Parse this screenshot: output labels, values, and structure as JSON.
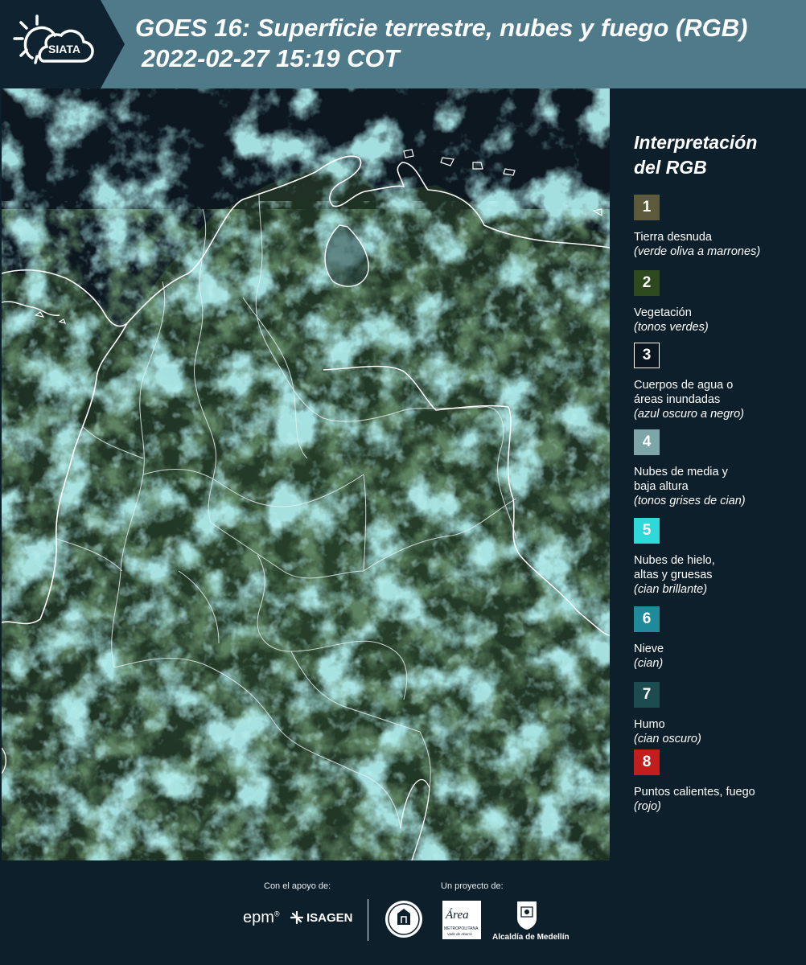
{
  "header": {
    "title": "GOES 16: Superficie terrestre, nubes y fuego (RGB)",
    "subtitle": "2022-02-27 15:19 COT",
    "logo_text": "SIATA"
  },
  "legend": {
    "title_line1": "Interpretación",
    "title_line2": "del RGB",
    "items": [
      {
        "number": "1",
        "name": "Tierra desnuda",
        "desc": "(verde oliva a marrones)",
        "color": "#5e5a3c"
      },
      {
        "number": "2",
        "name": "Vegetación",
        "desc": "(tonos verdes)",
        "color": "#2d4a1e"
      },
      {
        "number": "3",
        "name": "Cuerpos de agua o\náreas inundadas",
        "desc": "(azul oscuro a negro)",
        "color": "#0a1620"
      },
      {
        "number": "4",
        "name": "Nubes de media y\nbaja altura",
        "desc": "(tonos grises de cian)",
        "color": "#7ea6a8"
      },
      {
        "number": "5",
        "name": "Nubes de hielo,\naltas y gruesas",
        "desc": "(cian brillante)",
        "color": "#2fd9d9"
      },
      {
        "number": "6",
        "name": "Nieve",
        "desc": "(cian)",
        "color": "#1f8a9a"
      },
      {
        "number": "7",
        "name": "Humo",
        "desc": "(cian oscuro)",
        "color": "#1c4b50"
      },
      {
        "number": "8",
        "name": "Puntos calientes, fuego",
        "desc": "(rojo)",
        "color": "#c21e1e"
      }
    ]
  },
  "footer": {
    "support_label": "Con el apoyo de:",
    "project_label": "Un proyecto de:",
    "sponsor_epm": "epm",
    "sponsor_isagen": "ISAGEN",
    "area_caption_top": "Área",
    "area_caption": "METROPOLITANA",
    "area_caption_sub": "Valle de Aburrá",
    "alcaldia_caption": "Alcaldía de Medellín"
  }
}
